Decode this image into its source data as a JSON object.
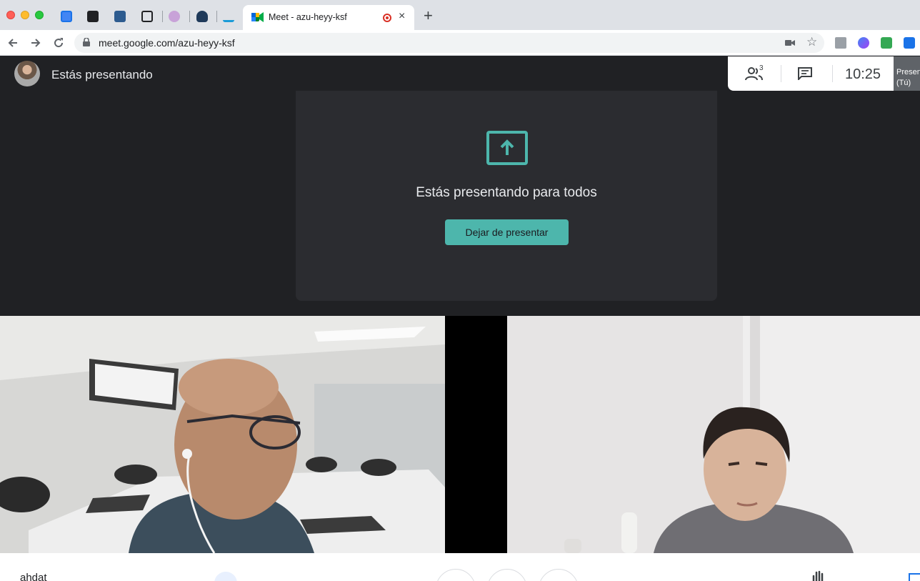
{
  "browser": {
    "active_tab_title": "Meet - azu-heyy-ksf",
    "url": "meet.google.com/azu-heyy-ksf",
    "new_tab_label": "+",
    "close_tab_label": "×"
  },
  "meet": {
    "presenting_banner": "Estás presentando",
    "participant_count": "3",
    "clock": "10:25",
    "self_tile_line1": "Presen",
    "self_tile_line2": "(Tú)",
    "present_card": {
      "title": "Estás presentando para todos",
      "stop_button": "Dejar de presentar"
    },
    "meeting_name": "ahdat"
  },
  "colors": {
    "accent": "#4db6ac",
    "meet_bg": "#202124",
    "card_bg": "#2b2c30"
  },
  "icons": [
    "lock-icon",
    "camera-icon",
    "star-icon",
    "people-icon",
    "chat-icon",
    "present-screen-icon",
    "raise-hand-icon",
    "shield-icon"
  ]
}
